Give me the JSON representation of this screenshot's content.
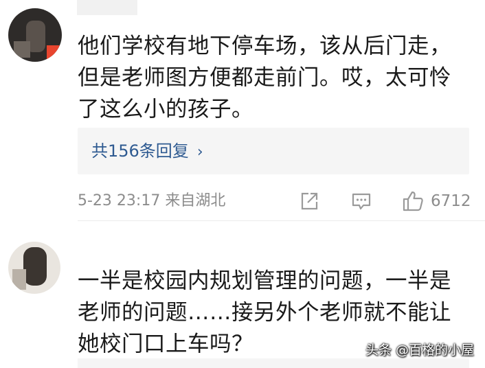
{
  "comments": [
    {
      "lines": [
        "他们学校有地下停车场，该从后门走，",
        "但是老师图方便都走前门。哎，太可怜",
        "了这么小的孩子。"
      ],
      "replies_label": "共156条回复",
      "replies_chevron": "›",
      "timestamp": "5-23 23:17",
      "location": "来自湖北",
      "like_count": "6712"
    },
    {
      "lines": [
        "一半是校园内规划管理的问题，一半是",
        "老师的问题……接另外个老师就不能让",
        "她校门口上车吗？"
      ]
    }
  ],
  "watermark": "头条 @百格的小屋",
  "colors": {
    "link": "#2e5a91",
    "meta": "#8c8c8c",
    "reply_box_bg": "#f5f5f5",
    "icon": "#9a9a9a"
  },
  "icons": {
    "share": "share-icon",
    "comment": "comment-icon",
    "like": "thumbs-up-icon"
  }
}
